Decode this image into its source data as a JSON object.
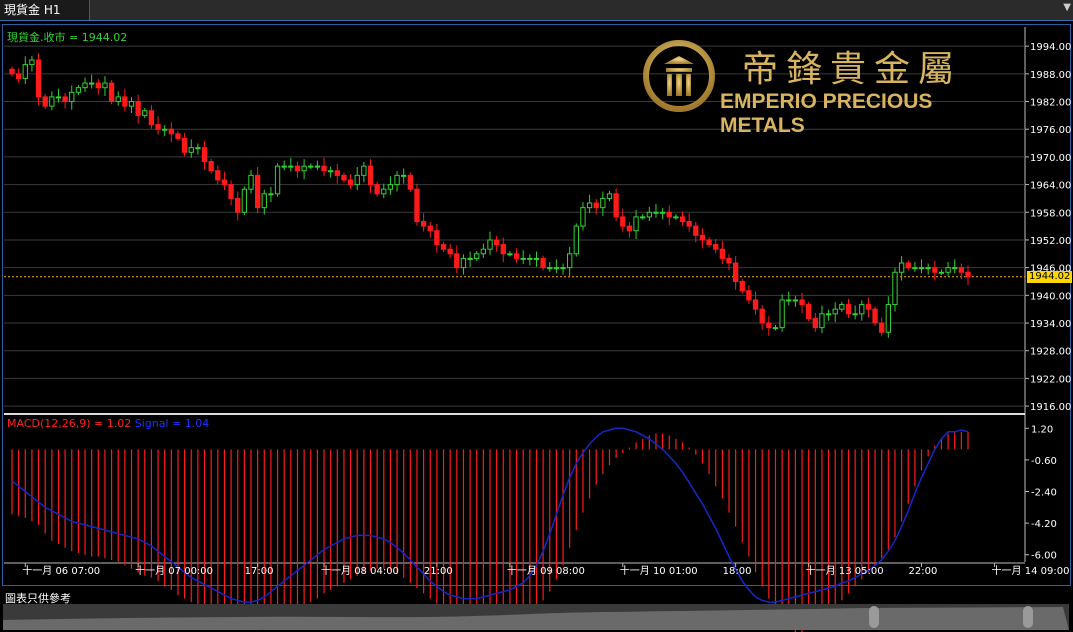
{
  "tab": {
    "title": "現貨金 H1",
    "menu_icon": "triangle-down-icon"
  },
  "legend": {
    "main": "現貨金.收市 = 1944.02",
    "macd": "MACD(12,26,9) = 1.02",
    "signal": "Signal = 1.04"
  },
  "logo": {
    "chinese": "帝鋒貴金屬",
    "english": "EMPERIO PRECIOUS METALS"
  },
  "footer": {
    "note": "圖表只供參考"
  },
  "current_price": "1944.02",
  "colors": {
    "up": "#32d232",
    "down": "#ff1a1a",
    "signal": "#1428c8",
    "price_line": "#ffa500",
    "logo": "#d8b360"
  },
  "chart_data": [
    {
      "type": "candlestick",
      "title": "",
      "yticks": [
        "1994.00",
        "1988.00",
        "1982.00",
        "1976.00",
        "1970.00",
        "1964.00",
        "1958.00",
        "1952.00",
        "1946.00",
        "1940.00",
        "1934.00",
        "1928.00",
        "1922.00",
        "1916.00"
      ],
      "ylim": [
        1914.5,
        1997.5
      ],
      "xticks": [
        "十一月 06 07:00",
        "十一月 07 00:00",
        "17:00",
        "十一月 08 04:00",
        "21:00",
        "十一月 09 08:00",
        "十一月 10 01:00",
        "18:00",
        "十一月 13 05:00",
        "22:00",
        "十一月 14 09:00"
      ],
      "x_label_bars": [
        2,
        19,
        37,
        47,
        64,
        75,
        92,
        109,
        120,
        137,
        148
      ],
      "current_price": 1944.02,
      "close": [
        1988,
        1987,
        1990,
        1991,
        1983,
        1981,
        1983,
        1983,
        1982,
        1984,
        1985,
        1986,
        1986,
        1985,
        1986,
        1982,
        1983,
        1981,
        1982,
        1979,
        1980,
        1977,
        1976,
        1976,
        1975,
        1974,
        1971,
        1972,
        1972,
        1969,
        1967,
        1965,
        1964,
        1961,
        1958,
        1963,
        1966,
        1959,
        1962,
        1962,
        1968,
        1968,
        1968,
        1967,
        1968,
        1968,
        1968,
        1967,
        1967,
        1966,
        1965,
        1964,
        1966,
        1968,
        1964,
        1962,
        1963,
        1964,
        1966,
        1966,
        1963,
        1956,
        1955,
        1954,
        1951,
        1950,
        1949,
        1946,
        1948,
        1948,
        1949,
        1950,
        1952,
        1951,
        1949,
        1949,
        1948,
        1948,
        1948,
        1948,
        1946,
        1946,
        1946,
        1946,
        1949,
        1955,
        1959,
        1960,
        1959,
        1961,
        1962,
        1957,
        1955,
        1954,
        1957,
        1957,
        1958,
        1958,
        1958,
        1957,
        1957,
        1956,
        1955,
        1953,
        1952,
        1951,
        1950,
        1948,
        1947,
        1943,
        1941,
        1939,
        1937,
        1934,
        1933,
        1933,
        1939,
        1939,
        1939,
        1938,
        1935,
        1933,
        1936,
        1936,
        1937,
        1938,
        1936,
        1936,
        1938,
        1937,
        1934,
        1932,
        1938,
        1945,
        1947,
        1946,
        1946,
        1946,
        1946,
        1945,
        1945,
        1946,
        1946,
        1945,
        1944
      ],
      "macd_histogram": [
        -3.7,
        -3.8,
        -3.9,
        -4.1,
        -4.3,
        -4.8,
        -5.2,
        -5.4,
        -5.6,
        -5.8,
        -5.9,
        -6.0,
        -6.1,
        -6.1,
        -6.2,
        -6.3,
        -6.4,
        -6.6,
        -6.8,
        -7.0,
        -7.2,
        -7.3,
        -7.5,
        -7.8,
        -8.0,
        -8.3,
        -8.5,
        -8.7,
        -8.9,
        -9.1,
        -9.3,
        -9.5,
        -9.7,
        -9.8,
        -10.0,
        -10.1,
        -10.2,
        -10.3,
        -10.2,
        -10.1,
        -9.9,
        -9.7,
        -9.5,
        -9.2,
        -9.0,
        -8.7,
        -8.5,
        -8.2,
        -8.0,
        -7.8,
        -7.6,
        -7.4,
        -7.2,
        -7.0,
        -6.9,
        -6.8,
        -6.8,
        -6.9,
        -7.1,
        -7.3,
        -7.6,
        -7.9,
        -8.2,
        -8.5,
        -8.8,
        -9.1,
        -9.4,
        -9.6,
        -9.8,
        -9.9,
        -10.0,
        -10.0,
        -10.0,
        -9.9,
        -9.8,
        -9.7,
        -9.6,
        -9.4,
        -9.2,
        -9.0,
        -8.6,
        -8.1,
        -7.4,
        -6.6,
        -5.6,
        -4.6,
        -3.6,
        -2.8,
        -2.0,
        -1.4,
        -0.9,
        -0.5,
        -0.2,
        0.1,
        0.4,
        0.6,
        0.8,
        0.9,
        0.9,
        0.8,
        0.6,
        0.4,
        0.1,
        -0.3,
        -0.8,
        -1.4,
        -2.1,
        -2.8,
        -3.6,
        -4.4,
        -5.3,
        -6.1,
        -7.0,
        -7.8,
        -8.5,
        -9.2,
        -9.8,
        -10.2,
        -10.4,
        -10.4,
        -10.2,
        -9.9,
        -9.6,
        -9.3,
        -8.9,
        -8.6,
        -8.2,
        -7.8,
        -7.4,
        -7.0,
        -6.6,
        -6.2,
        -5.7,
        -5.0,
        -4.1,
        -3.1,
        -2.1,
        -1.2,
        -0.4,
        0.2,
        0.6,
        0.9,
        1.0,
        1.0,
        1.0
      ],
      "macd_signal": [
        -1.8,
        -2.1,
        -2.4,
        -2.7,
        -3.0,
        -3.3,
        -3.5,
        -3.7,
        -3.9,
        -4.1,
        -4.2,
        -4.3,
        -4.4,
        -4.5,
        -4.6,
        -4.7,
        -4.8,
        -4.9,
        -5.0,
        -5.1,
        -5.3,
        -5.5,
        -5.8,
        -6.1,
        -6.4,
        -6.7,
        -7.0,
        -7.3,
        -7.5,
        -7.7,
        -7.9,
        -8.1,
        -8.3,
        -8.5,
        -8.6,
        -8.7,
        -8.7,
        -8.6,
        -8.4,
        -8.1,
        -7.8,
        -7.5,
        -7.2,
        -6.9,
        -6.6,
        -6.3,
        -6.0,
        -5.7,
        -5.5,
        -5.3,
        -5.1,
        -5.0,
        -4.9,
        -4.9,
        -4.9,
        -5.0,
        -5.1,
        -5.3,
        -5.6,
        -5.9,
        -6.3,
        -6.7,
        -7.1,
        -7.5,
        -7.8,
        -8.1,
        -8.3,
        -8.4,
        -8.5,
        -8.5,
        -8.5,
        -8.4,
        -8.3,
        -8.2,
        -8.1,
        -8.0,
        -7.8,
        -7.6,
        -7.2,
        -6.6,
        -5.8,
        -4.8,
        -3.7,
        -2.6,
        -1.6,
        -0.8,
        -0.2,
        0.3,
        0.7,
        1.0,
        1.1,
        1.2,
        1.2,
        1.1,
        1.0,
        0.8,
        0.6,
        0.3,
        0.0,
        -0.4,
        -0.8,
        -1.3,
        -1.9,
        -2.5,
        -3.1,
        -3.8,
        -4.5,
        -5.3,
        -6.1,
        -6.8,
        -7.5,
        -8.0,
        -8.4,
        -8.6,
        -8.7,
        -8.7,
        -8.6,
        -8.5,
        -8.4,
        -8.3,
        -8.2,
        -8.1,
        -8.0,
        -7.9,
        -7.8,
        -7.6,
        -7.5,
        -7.3,
        -7.1,
        -6.9,
        -6.6,
        -6.3,
        -5.8,
        -5.2,
        -4.4,
        -3.5,
        -2.5,
        -1.6,
        -0.8,
        0.0,
        0.6,
        1.0,
        1.0,
        1.1,
        1.0
      ],
      "macd_yticks": [
        "1.20",
        "-0.60",
        "-2.40",
        "-4.20",
        "-6.00"
      ],
      "macd_ylim": [
        -6.3,
        1.9
      ]
    }
  ]
}
